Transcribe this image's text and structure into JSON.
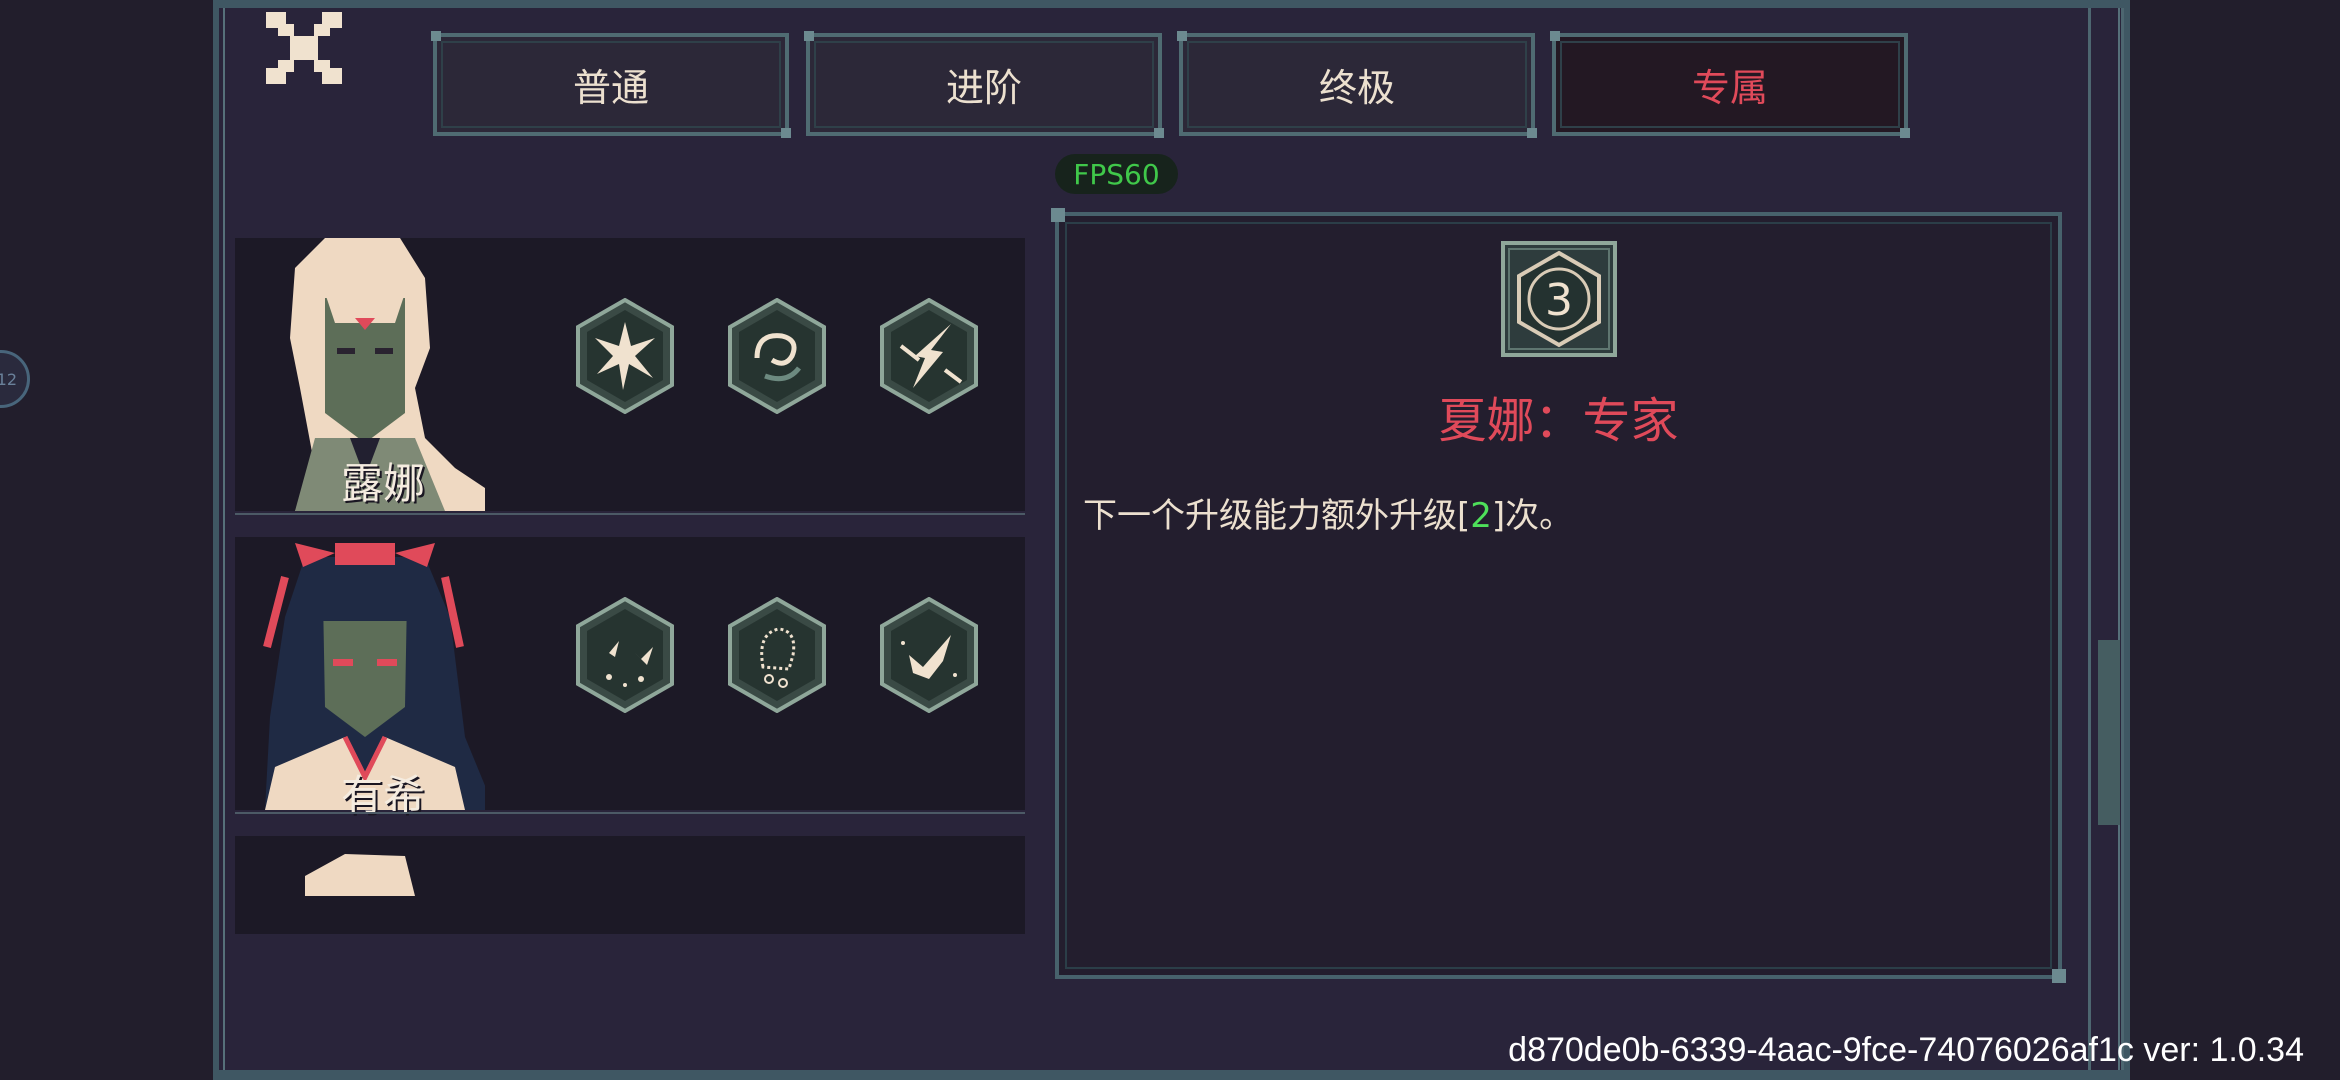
{
  "side_bubble": {
    "text": "12"
  },
  "tabs": [
    {
      "label": "普通",
      "active": false
    },
    {
      "label": "进阶",
      "active": false
    },
    {
      "label": "终极",
      "active": false
    },
    {
      "label": "专属",
      "active": true
    }
  ],
  "fps": "FPS60",
  "characters": [
    {
      "name": "露娜",
      "abilities": [
        "burst-ability-icon",
        "swirl-ability-icon",
        "lightning-ability-icon"
      ]
    },
    {
      "name": "有希",
      "abilities": [
        "birds-ability-icon",
        "ghost-ability-icon",
        "dove-ability-icon"
      ]
    },
    {
      "name": "",
      "abilities": []
    }
  ],
  "detail": {
    "badge_number": "3",
    "title": "夏娜：专家",
    "desc_before": "下一个升级能力额外升级[",
    "desc_number": "2",
    "desc_after": "]次。"
  },
  "version_text": "d870de0b-6339-4aac-9fce-74076026af1c ver: 1.0.34",
  "colors": {
    "accent_red": "#e04a5a",
    "highlight_green": "#4ee05a",
    "frame": "#4f6b72",
    "bg": "#221e2c"
  }
}
